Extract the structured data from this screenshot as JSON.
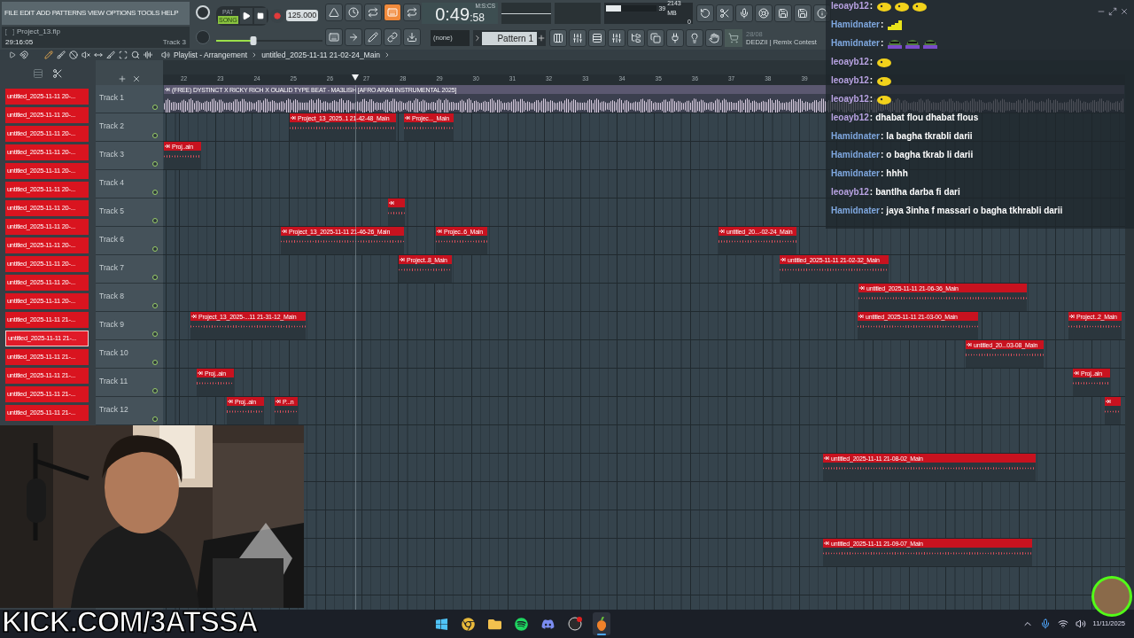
{
  "menu": [
    "FILE",
    "EDIT",
    "ADD",
    "PATTERNS",
    "VIEW",
    "OPTIONS",
    "TOOLS",
    "HELP"
  ],
  "project": {
    "file": "Project_13.flp",
    "time": "29:16:05",
    "track": "Track 3"
  },
  "transport": {
    "modes": [
      {
        "label": "PAT",
        "selected": false
      },
      {
        "label": "SONG",
        "selected": true
      }
    ],
    "tempo": "125.000",
    "pitch": {
      "level": 0.35
    }
  },
  "toolbar_buttons": [
    {
      "on": false
    },
    {
      "on": false
    },
    {
      "on": false
    },
    {
      "on": true
    },
    {
      "on": false
    }
  ],
  "clock": {
    "time": "0:49",
    "centis": ":58",
    "unit": "M:S:CS"
  },
  "monitor": {
    "cpu": "39",
    "memory": "2143 MB",
    "polyphony": "0",
    "level": 0.3
  },
  "pattern": {
    "channel": "(none)",
    "name": "Pattern 1"
  },
  "hint": {
    "date": "28/08",
    "text": "DEDZII | Remix Contest"
  },
  "playlist": {
    "title": "Playlist - Arrangement",
    "pattern": "untitled_2025-11-11 21-02-24_Main",
    "ruler": [
      "22",
      "23",
      "24",
      "25",
      "26",
      "27",
      "28",
      "29",
      "30",
      "31",
      "32",
      "33",
      "34",
      "35",
      "36",
      "37",
      "38",
      "39"
    ],
    "playhead": {
      "level": 0.2
    },
    "tracks": [
      {
        "name": "Track 1",
        "clips": [
          {
            "kind": "audio",
            "label": "(FREE) DYSTINCT X RICKY RICH X OUALID TYPE BEAT - MA3LISH [AFRO ARAB INSTRUMENTAL 2025]"
          }
        ]
      },
      {
        "name": "Track 2",
        "clips": [
          {
            "kind": "pattern",
            "label": "Project_13_2025..1 21-42-48_Main"
          },
          {
            "kind": "pattern",
            "label": "Projec..._Main"
          }
        ]
      },
      {
        "name": "Track 3",
        "clips": [
          {
            "kind": "pattern",
            "label": "Proj..ain"
          }
        ]
      },
      {
        "name": "Track 4"
      },
      {
        "name": "Track 5",
        "clips": [
          {
            "kind": "pattern"
          }
        ]
      },
      {
        "name": "Track 6",
        "clips": [
          {
            "kind": "pattern",
            "label": "Project_13_2025-11-11 21-46-26_Main"
          },
          {
            "kind": "pattern",
            "label": "Projec..6_Main"
          },
          {
            "kind": "pattern",
            "label": "untitled_20...-02-24_Main"
          }
        ]
      },
      {
        "name": "Track 7",
        "clips": [
          {
            "kind": "pattern",
            "label": "Project..8_Main"
          },
          {
            "kind": "pattern",
            "label": "untitled_2025-11-11 21-02-32_Main"
          }
        ]
      },
      {
        "name": "Track 8",
        "clips": [
          {
            "kind": "pattern",
            "label": "untitled_2025-11-11 21-06-36_Main"
          }
        ]
      },
      {
        "name": "Track 9",
        "clips": [
          {
            "kind": "pattern",
            "label": "Project_13_2025-...11 21-31-12_Main"
          },
          {
            "kind": "pattern",
            "label": "untitled_2025-11-11 21-03-00_Main"
          },
          {
            "kind": "pattern",
            "label": "Project..2_Main"
          }
        ]
      },
      {
        "name": "Track 10",
        "clips": [
          {
            "kind": "pattern",
            "label": "untitled_20...03-08_Main"
          }
        ]
      },
      {
        "name": "Track 11",
        "clips": [
          {
            "kind": "pattern",
            "label": "Proj..ain"
          },
          {
            "kind": "pattern",
            "label": "Proj..ain"
          }
        ]
      },
      {
        "name": "Track 12",
        "clips": [
          {
            "kind": "pattern",
            "label": "Proj..ain"
          },
          {
            "kind": "pattern",
            "label": "P...n"
          },
          {
            "kind": "pattern"
          }
        ]
      }
    ],
    "lower_clips": [
      {
        "kind": "pattern",
        "label": "untitled_2025-11-11 21-08-02_Main"
      },
      {
        "kind": "pattern",
        "label": "untitled_2025-11-11 21-09-07_Main"
      }
    ]
  },
  "patterns": [
    {
      "label": "untitled_2025-11-11 20-...",
      "selected": false
    },
    {
      "label": "untitled_2025-11-11 20-...",
      "selected": false
    },
    {
      "label": "untitled_2025-11-11 20-...",
      "selected": false
    },
    {
      "label": "untitled_2025-11-11 20-...",
      "selected": false
    },
    {
      "label": "untitled_2025-11-11 20-...",
      "selected": false
    },
    {
      "label": "untitled_2025-11-11 20-...",
      "selected": false
    },
    {
      "label": "untitled_2025-11-11 20-...",
      "selected": false
    },
    {
      "label": "untitled_2025-11-11 20-...",
      "selected": false
    },
    {
      "label": "untitled_2025-11-11 20-...",
      "selected": false
    },
    {
      "label": "untitled_2025-11-11 20-...",
      "selected": false
    },
    {
      "label": "untitled_2025-11-11 20-...",
      "selected": false
    },
    {
      "label": "untitled_2025-11-11 20-...",
      "selected": false
    },
    {
      "label": "untitled_2025-11-11 21-...",
      "selected": false
    },
    {
      "label": "untitled_2025-11-11 21-...",
      "selected": true
    },
    {
      "label": "untitled_2025-11-11 21-...",
      "selected": false
    },
    {
      "label": "untitled_2025-11-11 21-...",
      "selected": false
    },
    {
      "label": "untitled_2025-11-11 21-...",
      "selected": false
    },
    {
      "label": "untitled_2025-11-11 21-...",
      "selected": false
    }
  ],
  "chat": [
    {
      "user": "leoayb12",
      "separator": ":",
      "color": "#b9a3e3",
      "emotes": [
        {
          "kind": "blob"
        },
        {
          "kind": "blob"
        },
        {
          "kind": "blob"
        }
      ]
    },
    {
      "user": "Hamidnater",
      "separator": ":",
      "color": "#7fa8e0",
      "emotes": [
        {
          "kind": "bars"
        }
      ]
    },
    {
      "user": "Hamidnater",
      "separator": ":",
      "color": "#7fa8e0",
      "emotes": [
        {
          "kind": "car"
        },
        {
          "kind": "car"
        },
        {
          "kind": "car"
        }
      ]
    },
    {
      "user": "leoayb12",
      "separator": ":",
      "color": "#b9a3e3",
      "emotes": [
        {
          "kind": "blob"
        }
      ]
    },
    {
      "user": "leoayb12",
      "separator": ":",
      "color": "#b9a3e3",
      "emotes": [
        {
          "kind": "blob"
        }
      ]
    },
    {
      "user": "leoayb12",
      "separator": ":",
      "color": "#b9a3e3",
      "emotes": [
        {
          "kind": "blob"
        }
      ]
    },
    {
      "user": "leoayb12",
      "separator": ":",
      "color": "#b9a3e3",
      "text": "dhabat flou dhabat flous"
    },
    {
      "user": "Hamidnater",
      "separator": ":",
      "color": "#7fa8e0",
      "text": "la bagha tkrabli darii"
    },
    {
      "user": "Hamidnater",
      "separator": ":",
      "color": "#7fa8e0",
      "text": "o bagha tkrab li darii"
    },
    {
      "user": "Hamidnater",
      "separator": ":",
      "color": "#7fa8e0",
      "text": "hhhh"
    },
    {
      "user": "leoayb12",
      "separator": ":",
      "color": "#b9a3e3",
      "text": "bantlha darba fi dari"
    },
    {
      "user": "Hamidnater",
      "separator": ":",
      "color": "#7fa8e0",
      "text": "jaya 3inha f massari o bagha tkhrabli darii"
    }
  ],
  "stream_url": "KICK.COM/3ATSSA",
  "taskbar": {
    "apps": [
      {
        "kind": "start",
        "selected": false
      },
      {
        "kind": "browser",
        "selected": false
      },
      {
        "kind": "files",
        "selected": false
      },
      {
        "kind": "music",
        "selected": false
      },
      {
        "kind": "chat",
        "selected": false
      },
      {
        "kind": "recorder",
        "selected": false
      },
      {
        "kind": "daw",
        "selected": true
      }
    ],
    "date": "11/11/2025"
  }
}
